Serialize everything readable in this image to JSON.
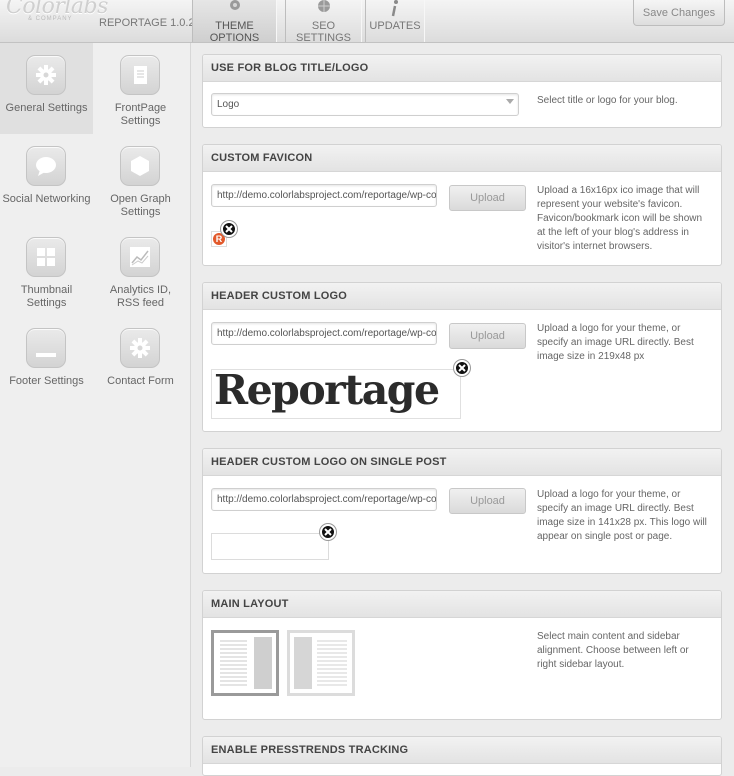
{
  "topbar": {
    "brand": "Colorlabs",
    "brand_sub": "& COMPANY",
    "version": "REPORTAGE 1.0.2",
    "tabs": [
      {
        "label": "THEME OPTIONS",
        "icon": "gear-icon",
        "active": true
      },
      {
        "label": "SEO SETTINGS",
        "icon": "globe-icon",
        "active": false
      },
      {
        "label": "UPDATES",
        "icon": "info-icon",
        "active": false
      }
    ],
    "save_label": "Save Changes"
  },
  "sidebar": {
    "items": [
      {
        "label": "General Settings",
        "icon": "gear-icon",
        "active": true
      },
      {
        "label": "FrontPage Settings",
        "icon": "page-icon",
        "active": false
      },
      {
        "label": "Social Networking",
        "icon": "speech-bubble-icon",
        "active": false
      },
      {
        "label": "Open Graph Settings",
        "icon": "hexagon-icon",
        "active": false
      },
      {
        "label": "Thumbnail Settings",
        "icon": "grid-icon",
        "active": false
      },
      {
        "label": "Analytics ID, RSS feed",
        "icon": "chart-icon",
        "active": false
      },
      {
        "label": "Footer Settings",
        "icon": "footer-icon",
        "active": false
      },
      {
        "label": "Contact Form",
        "icon": "gear-icon",
        "active": false
      }
    ]
  },
  "sections": {
    "blog_title": {
      "title": "USE FOR BLOG TITLE/LOGO",
      "selected": "Logo",
      "desc": "Select title or logo for your blog."
    },
    "favicon": {
      "title": "CUSTOM FAVICON",
      "value": "http://demo.colorlabsproject.com/reportage/wp-content/uploads/favicon.ico",
      "upload": "Upload",
      "desc": "Upload a 16x16px ico image that will represent your website's favicon. Favicon/bookmark icon will be shown at the left of your blog's address in visitor's internet browsers.",
      "preview_letter": "R"
    },
    "logo": {
      "title": "HEADER CUSTOM LOGO",
      "value": "http://demo.colorlabsproject.com/reportage/wp-content/uploads/logo.png",
      "upload": "Upload",
      "desc": "Upload a logo for your theme, or specify an image URL directly. Best image size in 219x48 px",
      "preview_text": "Reportage"
    },
    "logo_single": {
      "title": "HEADER CUSTOM LOGO ON SINGLE POST",
      "value": "http://demo.colorlabsproject.com/reportage/wp-content/uploads/logo-single.png",
      "upload": "Upload",
      "desc": "Upload a logo for your theme, or specify an image URL directly. Best image size in 141x28 px. This logo will appear on single post or page."
    },
    "layout": {
      "title": "MAIN LAYOUT",
      "desc": "Select main content and sidebar alignment. Choose between left or right sidebar layout.",
      "options": [
        "content-left",
        "content-right"
      ],
      "selected": "content-left"
    },
    "presstrends": {
      "title": "ENABLE PRESSTRENDS TRACKING"
    }
  }
}
